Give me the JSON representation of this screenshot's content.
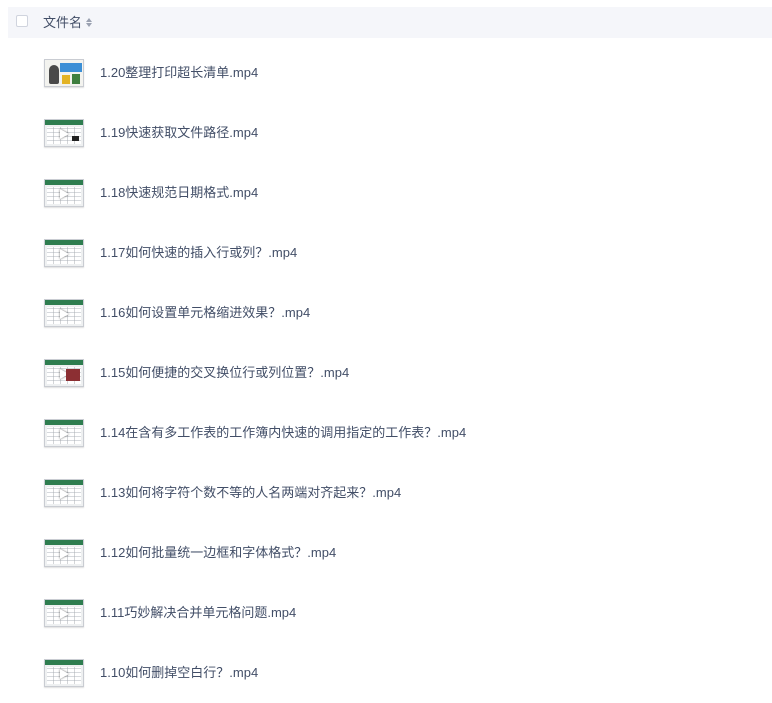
{
  "header": {
    "column_title": "文件名"
  },
  "files": [
    {
      "name": "1.20整理打印超长清单.mp4",
      "thumb": "cover"
    },
    {
      "name": "1.19快速获取文件路径.mp4",
      "thumb": "sheet-dark"
    },
    {
      "name": "1.18快速规范日期格式.mp4",
      "thumb": "sheet"
    },
    {
      "name": "1.17如何快速的插入行或列？.mp4",
      "thumb": "sheet"
    },
    {
      "name": "1.16如何设置单元格缩进效果？.mp4",
      "thumb": "sheet"
    },
    {
      "name": "1.15如何便捷的交叉换位行或列位置？.mp4",
      "thumb": "sheet-red"
    },
    {
      "name": "1.14在含有多工作表的工作簿内快速的调用指定的工作表？.mp4",
      "thumb": "sheet"
    },
    {
      "name": "1.13如何将字符个数不等的人名两端对齐起来？.mp4",
      "thumb": "sheet"
    },
    {
      "name": "1.12如何批量统一边框和字体格式？.mp4",
      "thumb": "sheet"
    },
    {
      "name": "1.11巧妙解决合并单元格问题.mp4",
      "thumb": "sheet"
    },
    {
      "name": "1.10如何删掉空白行？.mp4",
      "thumb": "sheet"
    }
  ],
  "icons": {
    "checkbox": "checkbox-icon",
    "sort": "sort-icon",
    "thumbnail": "video-thumbnail-icon"
  },
  "colors": {
    "text": "#424e67",
    "header_bg": "#f5f6fa",
    "excel_green": "#2e7d4f"
  }
}
